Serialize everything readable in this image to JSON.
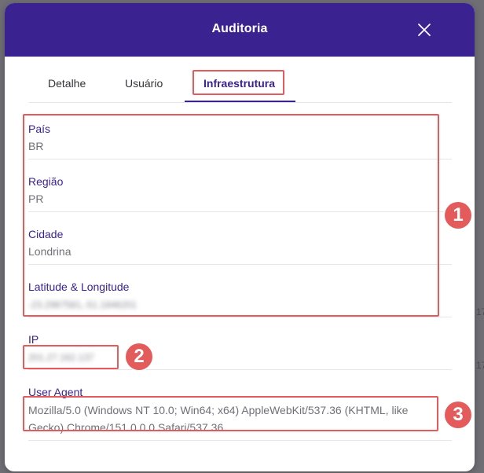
{
  "modal": {
    "title": "Auditoria",
    "close_icon": "close-icon"
  },
  "tabs": [
    {
      "label": "Detalhe",
      "active": false
    },
    {
      "label": "Usuário",
      "active": false
    },
    {
      "label": "Infraestrutura",
      "active": true
    }
  ],
  "fields": {
    "pais": {
      "label": "País",
      "value": "BR"
    },
    "regiao": {
      "label": "Região",
      "value": "PR"
    },
    "cidade": {
      "label": "Cidade",
      "value": "Londrina"
    },
    "latlng": {
      "label": "Latitude & Longitude",
      "value": "-23.2987581,-51.1846201"
    },
    "ip": {
      "label": "IP",
      "value": "201.27.162.137"
    },
    "user_agent": {
      "label": "User Agent",
      "value": "Mozilla/5.0 (Windows NT 10.0; Win64; x64) AppleWebKit/537.36 (KHTML, like Gecko) Chrome/151.0.0.0 Safari/537.36"
    }
  },
  "annotations": {
    "one": "1",
    "two": "2",
    "three": "3"
  },
  "colors": {
    "header": "#3b2291",
    "accent": "#3b2291",
    "annotation": "#e45b5b"
  }
}
